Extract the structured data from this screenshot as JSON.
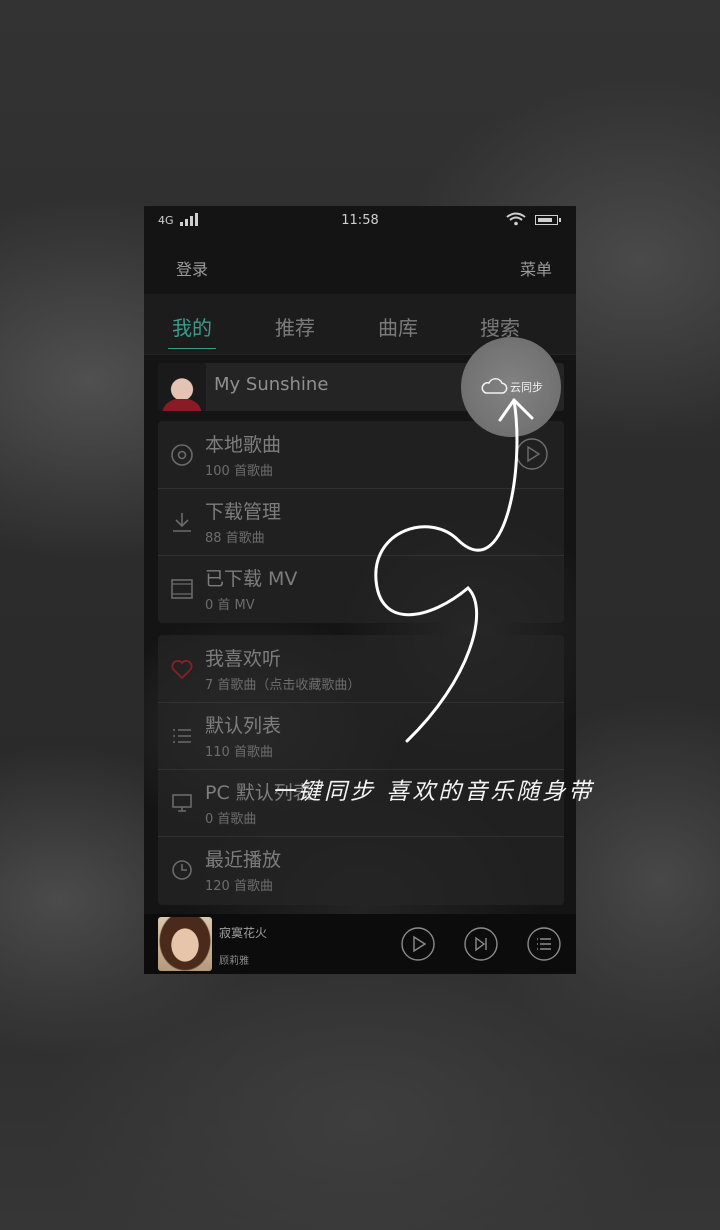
{
  "status_bar": {
    "carrier": "4G",
    "time": "11:58"
  },
  "header": {
    "login": "登录",
    "menu": "菜单"
  },
  "tabs": [
    {
      "label": "我的",
      "active": true
    },
    {
      "label": "推荐",
      "active": false
    },
    {
      "label": "曲库",
      "active": false
    },
    {
      "label": "搜索",
      "active": false
    }
  ],
  "profile": {
    "name": "My Sunshine",
    "sync_label": "云同步"
  },
  "library": {
    "local": {
      "title": "本地歌曲",
      "sub": "100 首歌曲"
    },
    "download": {
      "title": "下载管理",
      "sub": "88 首歌曲"
    },
    "mv": {
      "title": "已下载 MV",
      "sub": "0 首 MV"
    }
  },
  "playlists": {
    "favorite": {
      "title": "我喜欢听",
      "sub": "7 首歌曲（点击收藏歌曲）"
    },
    "default": {
      "title": "默认列表",
      "sub": "110 首歌曲"
    },
    "pc": {
      "title": "PC 默认列表",
      "sub": "0 首歌曲"
    },
    "recent": {
      "title": "最近播放",
      "sub": "120 首歌曲"
    }
  },
  "player": {
    "title": "寂寞花火",
    "artist": "顾莉雅"
  },
  "overlay": {
    "caption": "一键同步 喜欢的音乐随身带"
  },
  "colors": {
    "accent": "#3d9a8a",
    "heart": "#8a1d2a"
  }
}
